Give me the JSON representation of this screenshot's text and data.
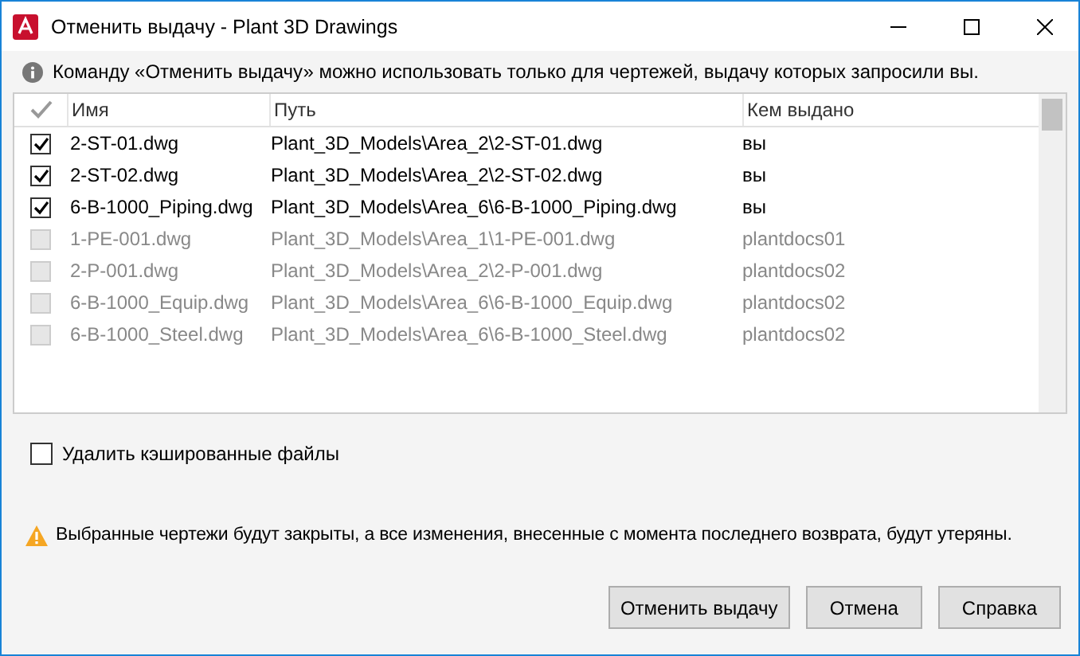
{
  "window": {
    "title": "Отменить выдачу - Plant 3D Drawings"
  },
  "info": "Команду «Отменить выдачу» можно использовать только для чертежей, выдачу которых запросили вы.",
  "table": {
    "columns": [
      "Имя",
      "Путь",
      "Кем выдано"
    ],
    "rows": [
      {
        "checked": true,
        "disabled": false,
        "cells": [
          "2-ST-01.dwg",
          "Plant_3D_Models\\Area_2\\2-ST-01.dwg",
          "вы"
        ]
      },
      {
        "checked": true,
        "disabled": false,
        "cells": [
          "2-ST-02.dwg",
          "Plant_3D_Models\\Area_2\\2-ST-02.dwg",
          "вы"
        ]
      },
      {
        "checked": true,
        "disabled": false,
        "cells": [
          "6-B-1000_Piping.dwg",
          "Plant_3D_Models\\Area_6\\6-B-1000_Piping.dwg",
          "вы"
        ]
      },
      {
        "checked": false,
        "disabled": true,
        "cells": [
          "1-PE-001.dwg",
          "Plant_3D_Models\\Area_1\\1-PE-001.dwg",
          "plantdocs01"
        ]
      },
      {
        "checked": false,
        "disabled": true,
        "cells": [
          "2-P-001.dwg",
          "Plant_3D_Models\\Area_2\\2-P-001.dwg",
          "plantdocs02"
        ]
      },
      {
        "checked": false,
        "disabled": true,
        "cells": [
          "6-B-1000_Equip.dwg",
          "Plant_3D_Models\\Area_6\\6-B-1000_Equip.dwg",
          "plantdocs02"
        ]
      },
      {
        "checked": false,
        "disabled": true,
        "cells": [
          "6-B-1000_Steel.dwg",
          "Plant_3D_Models\\Area_6\\6-B-1000_Steel.dwg",
          "plantdocs02"
        ]
      }
    ]
  },
  "delete_cached": {
    "label": "Удалить кэшированные файлы",
    "checked": false
  },
  "warning": "Выбранные чертежи будут закрыты, а все изменения, внесенные с момента последнего возврата, будут утеряны.",
  "buttons": [
    "Отменить выдачу",
    "Отмена",
    "Справка"
  ]
}
